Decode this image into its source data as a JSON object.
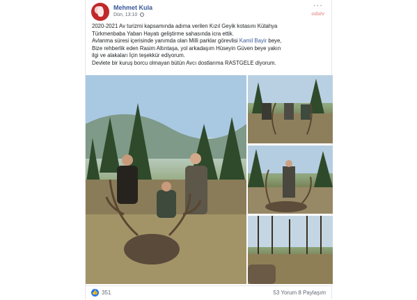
{
  "post": {
    "author": "Mehmet Kula",
    "time": "Dün, 13:10",
    "menu_icon": "···",
    "watermark": "odatv",
    "text_lines": [
      "2020-2021 Av turizmi kapsamında adıma verilen Kızıl Geyik kotasını Kütahya",
      "Türkmenbaba Yaban Hayatı geliştirme sahasında icra ettik.",
      "Avlanma süresi içerisinde yanımda olan Milli parklar görevlisi ",
      "Bize rehberlik eden Rasim Altıntaşa, yol arkadaşım Hüseyin Güven beye yakın",
      "ilgi ve alakaları İçin teşekkür ediyorum.",
      "Devlete bir kuruş borcu olmayan bütün Avcı dostlarıma RASTGELE diyorum."
    ],
    "mention_name": "Kamil Bayir",
    "mention_suffix": " beye,"
  },
  "footer": {
    "like_icon_glyph": "👍",
    "likes": "351",
    "comments": "53 Yorum",
    "shares": "8 Paylaşım"
  }
}
